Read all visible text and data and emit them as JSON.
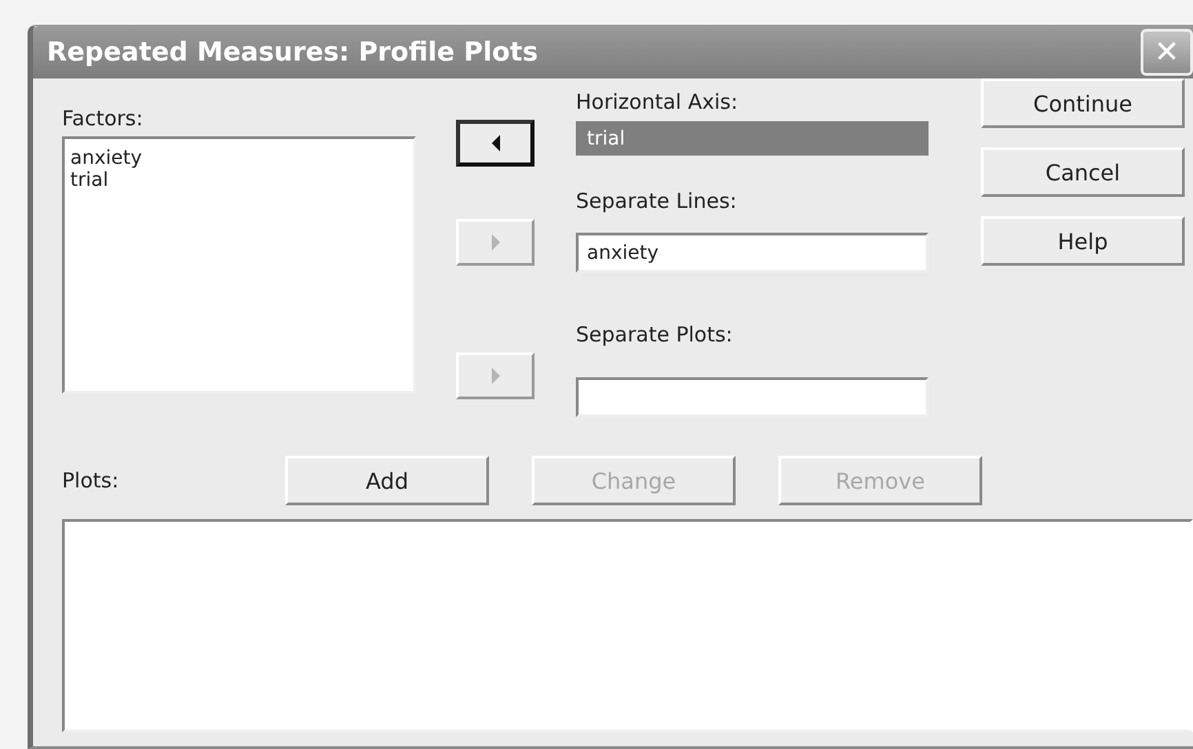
{
  "window": {
    "title": "Repeated Measures: Profile Plots",
    "close": "✕"
  },
  "factors": {
    "label": "Factors:",
    "items": [
      "anxiety",
      "trial"
    ]
  },
  "targets": [
    {
      "label": "Horizontal Axis:",
      "value": "trial",
      "selected": true,
      "arrow": {
        "kind": "left",
        "disabled": false
      }
    },
    {
      "label": "Separate Lines:",
      "value": "anxiety",
      "selected": false,
      "arrow": {
        "kind": "right",
        "disabled": true
      }
    },
    {
      "label": "Separate Plots:",
      "selected": false,
      "arrow": {
        "kind": "right",
        "disabled": true
      }
    }
  ],
  "side_buttons": [
    {
      "label": "Continue",
      "disabled": false
    },
    {
      "label": "Cancel",
      "disabled": false
    },
    {
      "label": "Help",
      "disabled": false
    }
  ],
  "plots": {
    "label": "Plots:",
    "buttons": [
      {
        "label": "Add",
        "disabled": false
      },
      {
        "label": "Change",
        "disabled": true
      },
      {
        "label": "Remove",
        "disabled": true
      }
    ]
  }
}
